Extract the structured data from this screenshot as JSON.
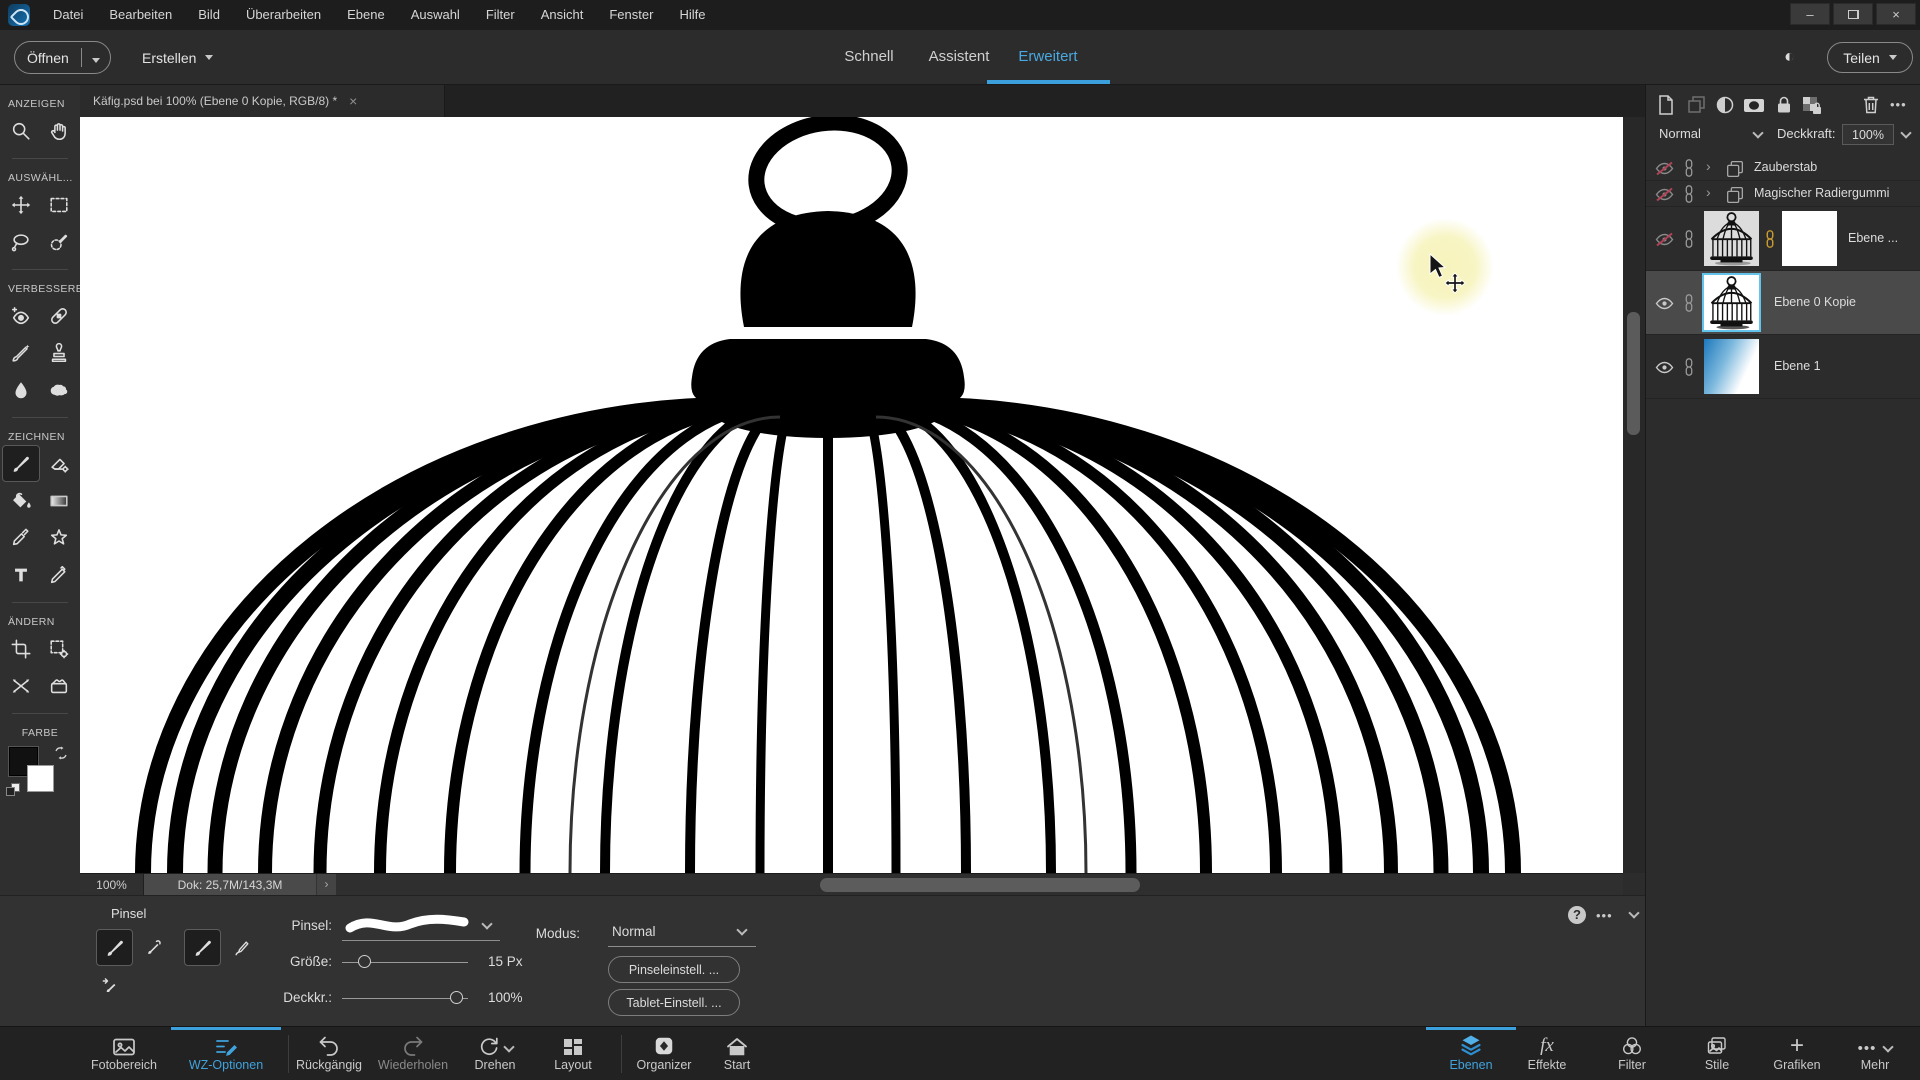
{
  "titlebar": {
    "menus": [
      "Datei",
      "Bearbeiten",
      "Bild",
      "Überarbeiten",
      "Ebene",
      "Auswahl",
      "Filter",
      "Ansicht",
      "Fenster",
      "Hilfe"
    ],
    "window_controls": {
      "minimize": "–",
      "close": "×"
    }
  },
  "appbar": {
    "open_label": "Öffnen",
    "create_label": "Erstellen",
    "mode_tabs": [
      {
        "label": "Schnell",
        "active": false
      },
      {
        "label": "Assistent",
        "active": false
      },
      {
        "label": "Erweitert",
        "active": true
      }
    ],
    "contrast_icon": "◐",
    "share_label": "Teilen"
  },
  "document_tab": {
    "title": "Käfig.psd bei 100% (Ebene 0 Kopie, RGB/8) *",
    "close": "×"
  },
  "toolbox": {
    "sections": [
      {
        "label": "ANZEIGEN",
        "tools": [
          "zoom",
          "hand"
        ]
      },
      {
        "label": "AUSWÄHL...",
        "tools": [
          "move",
          "marquee",
          "lasso",
          "quick-selection"
        ]
      },
      {
        "label": "VERBESSERE...",
        "tools": [
          "red-eye",
          "spot-healing",
          "smart-brush",
          "clone-stamp",
          "blur",
          "sponge"
        ]
      },
      {
        "label": "ZEICHNEN",
        "tools": [
          "brush",
          "eraser",
          "paint-bucket",
          "gradient",
          "eyedropper",
          "shape",
          "type",
          "pencil"
        ],
        "active_tool": "brush"
      },
      {
        "label": "ÄNDERN",
        "tools": [
          "crop",
          "recompose",
          "content-move",
          "frame"
        ]
      },
      {
        "label": "FARBE",
        "tools": [
          "foreground-swatch",
          "background-swatch",
          "swap-colors",
          "default-colors"
        ]
      }
    ]
  },
  "statusbar": {
    "zoom_level": "100%",
    "doc_info": "Dok: 25,7M/143,3M",
    "expander": "›"
  },
  "tool_options": {
    "panel_title": "Pinsel",
    "tool_icons": [
      "brush-selected",
      "impressionist-brush",
      "brush-variant-selected",
      "airbrush",
      "color-replacement-brush"
    ],
    "brush_label": "Pinsel:",
    "size_label": "Größe:",
    "size_value": "15 Px",
    "opacity_label": "Deckkr.:",
    "opacity_value": "100%",
    "mode_label": "Modus:",
    "mode_value": "Normal",
    "brush_settings_label": "Pinseleinstell. ...",
    "tablet_settings_label": "Tablet-Einstell. ...",
    "help_icon": "?",
    "more_icon": "•••"
  },
  "layers_panel": {
    "header_icons": [
      "new-layer",
      "copy-layer",
      "adjustment-layer",
      "layer-mask",
      "lock-all",
      "lock-transparency",
      "delete-layer",
      "more"
    ],
    "more_icon": "•••",
    "blend_mode": "Normal",
    "opacity_label": "Deckkraft:",
    "opacity_value": "100%",
    "expander": "›",
    "rows": [
      {
        "name": "Zauberstab",
        "type": "group",
        "visible": false
      },
      {
        "name": "Magischer Radiergummi",
        "type": "group",
        "visible": false
      },
      {
        "name": "Ebene ...",
        "type": "layer",
        "visible": false,
        "mask": true
      },
      {
        "name": "Ebene 0 Kopie",
        "type": "layer",
        "visible": true,
        "selected": true
      },
      {
        "name": "Ebene 1",
        "type": "layer",
        "visible": true
      }
    ]
  },
  "taskbar": {
    "left": [
      {
        "label": "Fotobereich",
        "active": false
      },
      {
        "label": "WZ-Optionen",
        "active": true
      },
      {
        "label": "Rückgängig",
        "active": false
      },
      {
        "label": "Wiederholen",
        "active": false
      },
      {
        "label": "Drehen",
        "active": false
      },
      {
        "label": "Layout",
        "active": false
      },
      {
        "label": "Organizer",
        "active": false
      },
      {
        "label": "Start",
        "active": false
      }
    ],
    "right": [
      {
        "label": "Ebenen",
        "active": true
      },
      {
        "label": "Effekte",
        "active": false
      },
      {
        "label": "Filter",
        "active": false
      },
      {
        "label": "Stile",
        "active": false
      },
      {
        "label": "Grafiken",
        "active": false
      },
      {
        "label": "Mehr",
        "active": false
      }
    ],
    "grafiken_glyph": "+",
    "mehr_glyph": "•••",
    "fx_glyph": "fx"
  },
  "colors": {
    "accent_blue": "#3ba0dc",
    "selection_border": "#63c3ea",
    "hidden_eye_red": "#b24257",
    "link_gold": "#c99a2e",
    "highlight_yellow": "#f6f3b9"
  }
}
